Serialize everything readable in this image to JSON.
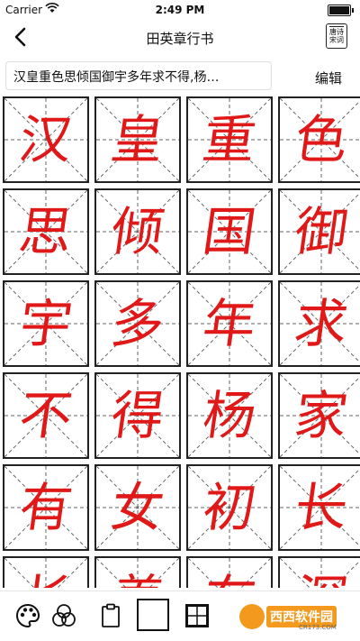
{
  "status_bar": {
    "carrier": "Carrier",
    "time": "2:49 PM"
  },
  "nav": {
    "title": "田英章行书",
    "poem_button_lines": [
      "唐诗",
      "宋词"
    ]
  },
  "text_row": {
    "text": "汉皇重色思倾国御宇多年求不得,杨…",
    "edit_label": "编辑"
  },
  "grid": {
    "characters": [
      "汉",
      "皇",
      "重",
      "色",
      "思",
      "倾",
      "国",
      "御",
      "宇",
      "多",
      "年",
      "求",
      "不",
      "得",
      "杨",
      "家",
      "有",
      "女",
      "初",
      "长",
      "长",
      "养",
      "在",
      "深"
    ],
    "char_color": "#e01818",
    "guide_color": "#666666"
  },
  "toolbar": {
    "tools": [
      "palette-icon",
      "color-mix-icon",
      "clipboard-icon",
      "square-frame-icon",
      "grid-style-icon"
    ]
  },
  "watermark": {
    "text": "西西软件园",
    "sub": "CR173.COM"
  }
}
